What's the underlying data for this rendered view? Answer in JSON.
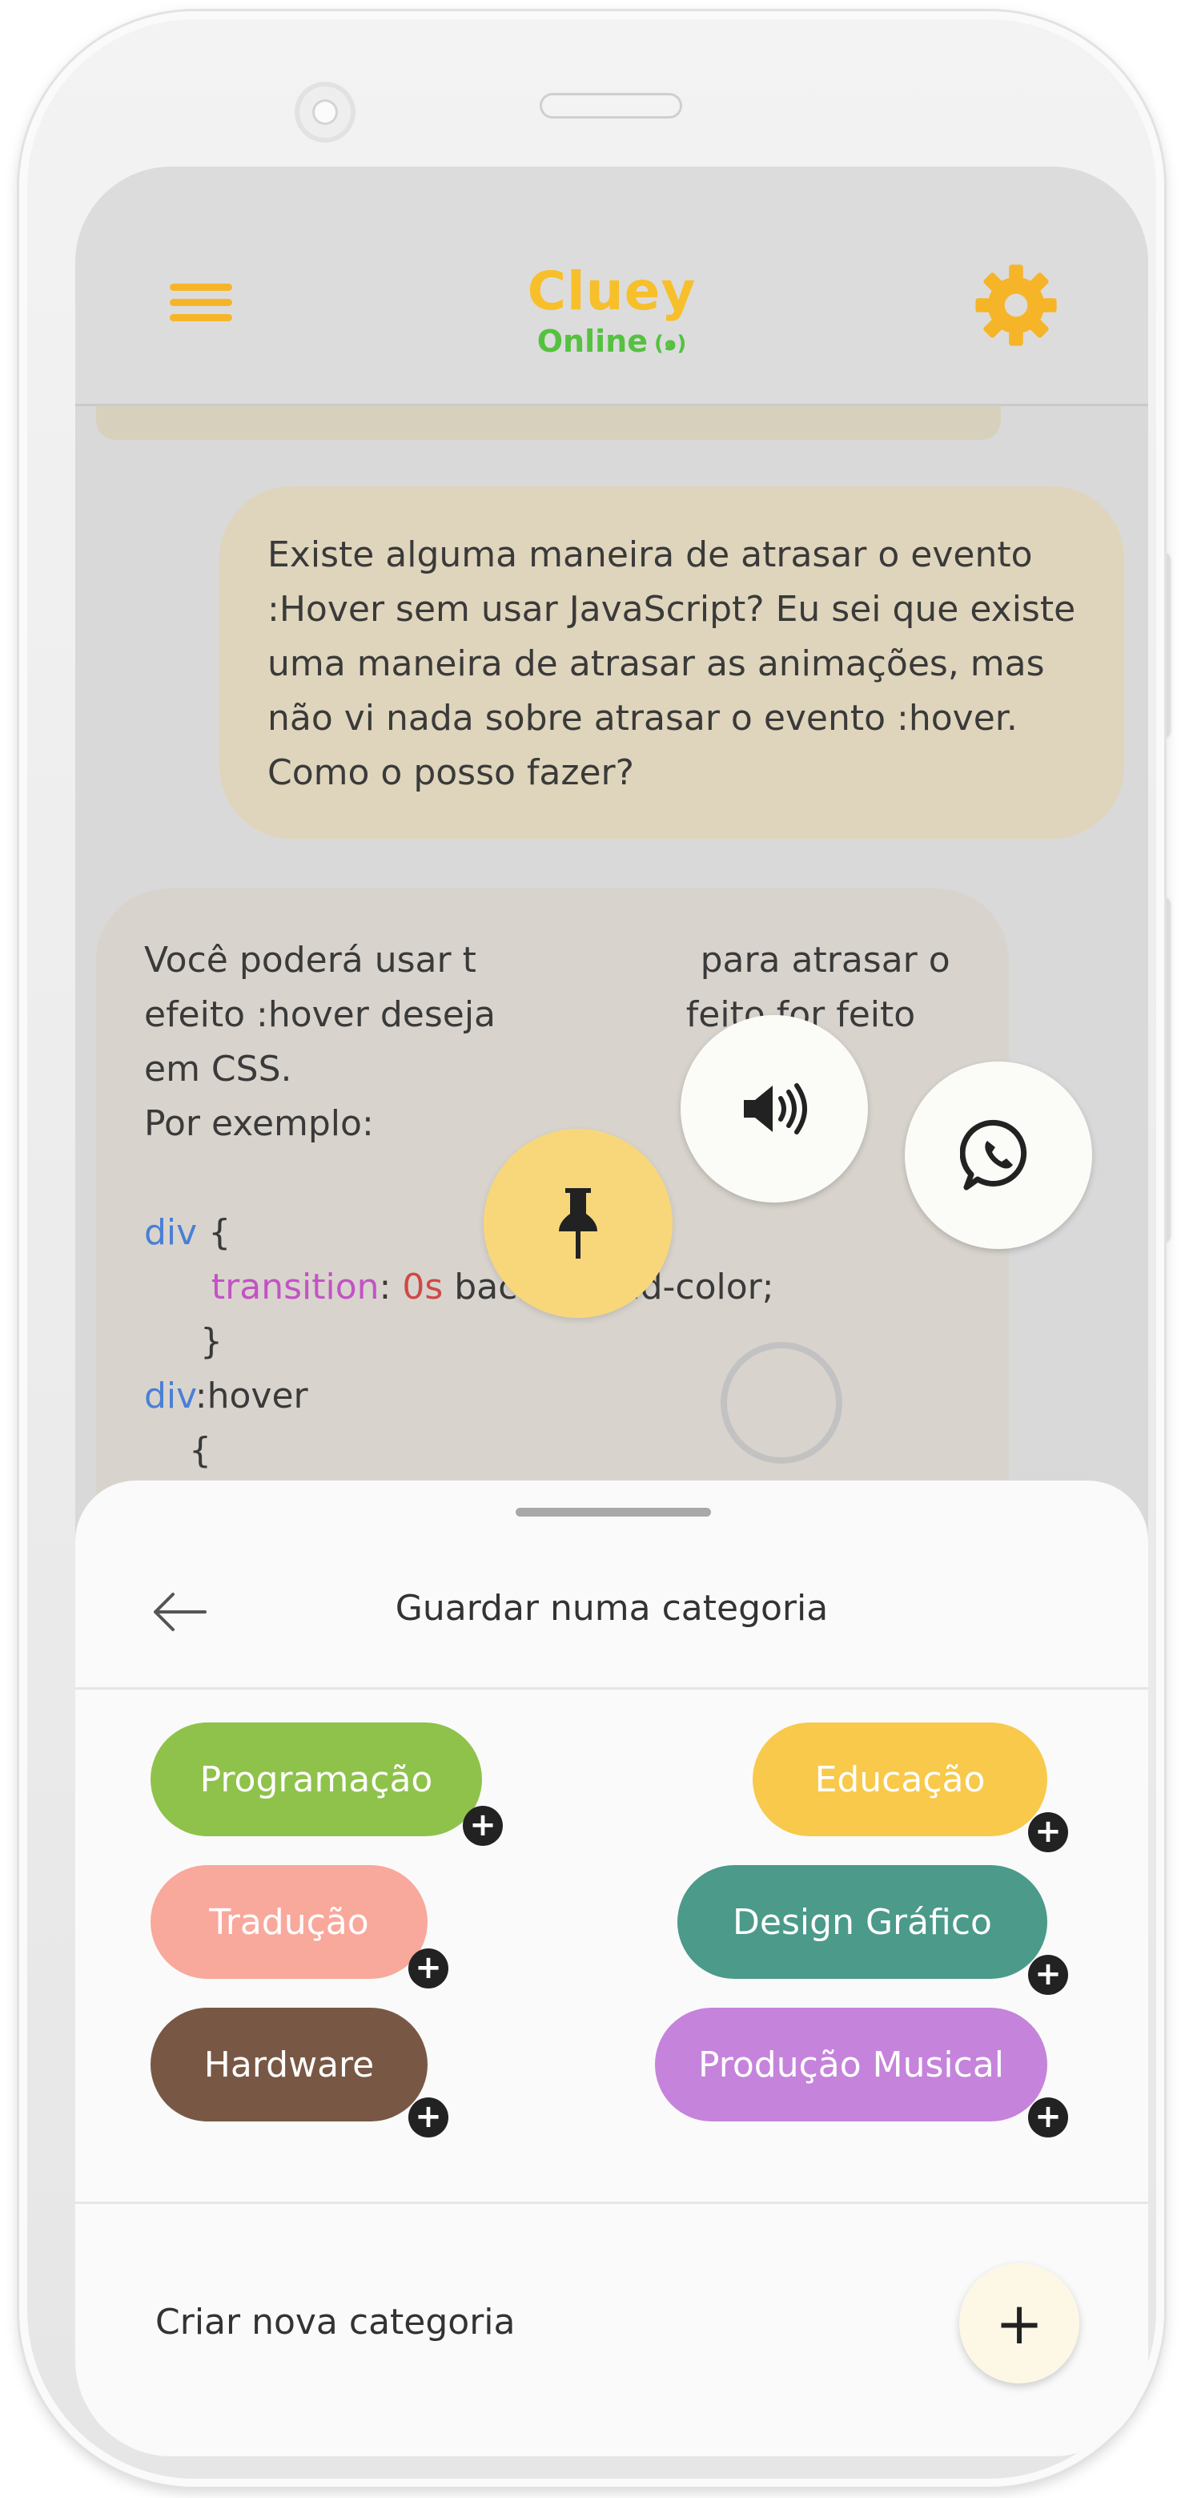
{
  "app": {
    "title": "Cluey",
    "status": "Online",
    "status_icon": "(๑)",
    "accent_color": "#f7bf2a",
    "online_color": "#55c140"
  },
  "chat": {
    "user_message": "Existe alguma maneira de atrasar o evento :Hover sem usar JavaScript? Eu sei que existe uma maneira de atrasar as animações, mas não vi nada sobre atrasar o evento :hover. Como o posso fazer?",
    "bot_lines": {
      "l1": "Você poderá usar t",
      "l1b": "para atrasar o",
      "l2": "efeito :hover deseja",
      "l2b": "feito for feito",
      "l3": "em CSS.",
      "l4": "Por exemplo:",
      "code_div1": "div",
      "code_brace_open1": " {",
      "code_prop": "transition",
      "code_colon": ": ",
      "code_num": "0s",
      "code_rest": " background-color;",
      "code_brace_close": "}",
      "code_div2": "div",
      "code_hover": ":hover",
      "code_brace_open2": "{"
    }
  },
  "actions": {
    "sound_icon": "speaker-icon",
    "whatsapp_icon": "whatsapp-icon",
    "pin_icon": "pin-icon"
  },
  "sheet": {
    "title": "Guardar numa categoria",
    "categories": [
      {
        "label": "Programação",
        "color": "#8fc24a"
      },
      {
        "label": "Educação",
        "color": "#f8c94a"
      },
      {
        "label": "Tradução",
        "color": "#f9a89c"
      },
      {
        "label": "Design Gráfico",
        "color": "#4b9a8a"
      },
      {
        "label": "Hardware",
        "color": "#785845"
      },
      {
        "label": "Produção Musical",
        "color": "#c583db"
      }
    ],
    "plus_symbol": "+",
    "new_category_label": "Criar nova categoria",
    "add_symbol": "+"
  }
}
